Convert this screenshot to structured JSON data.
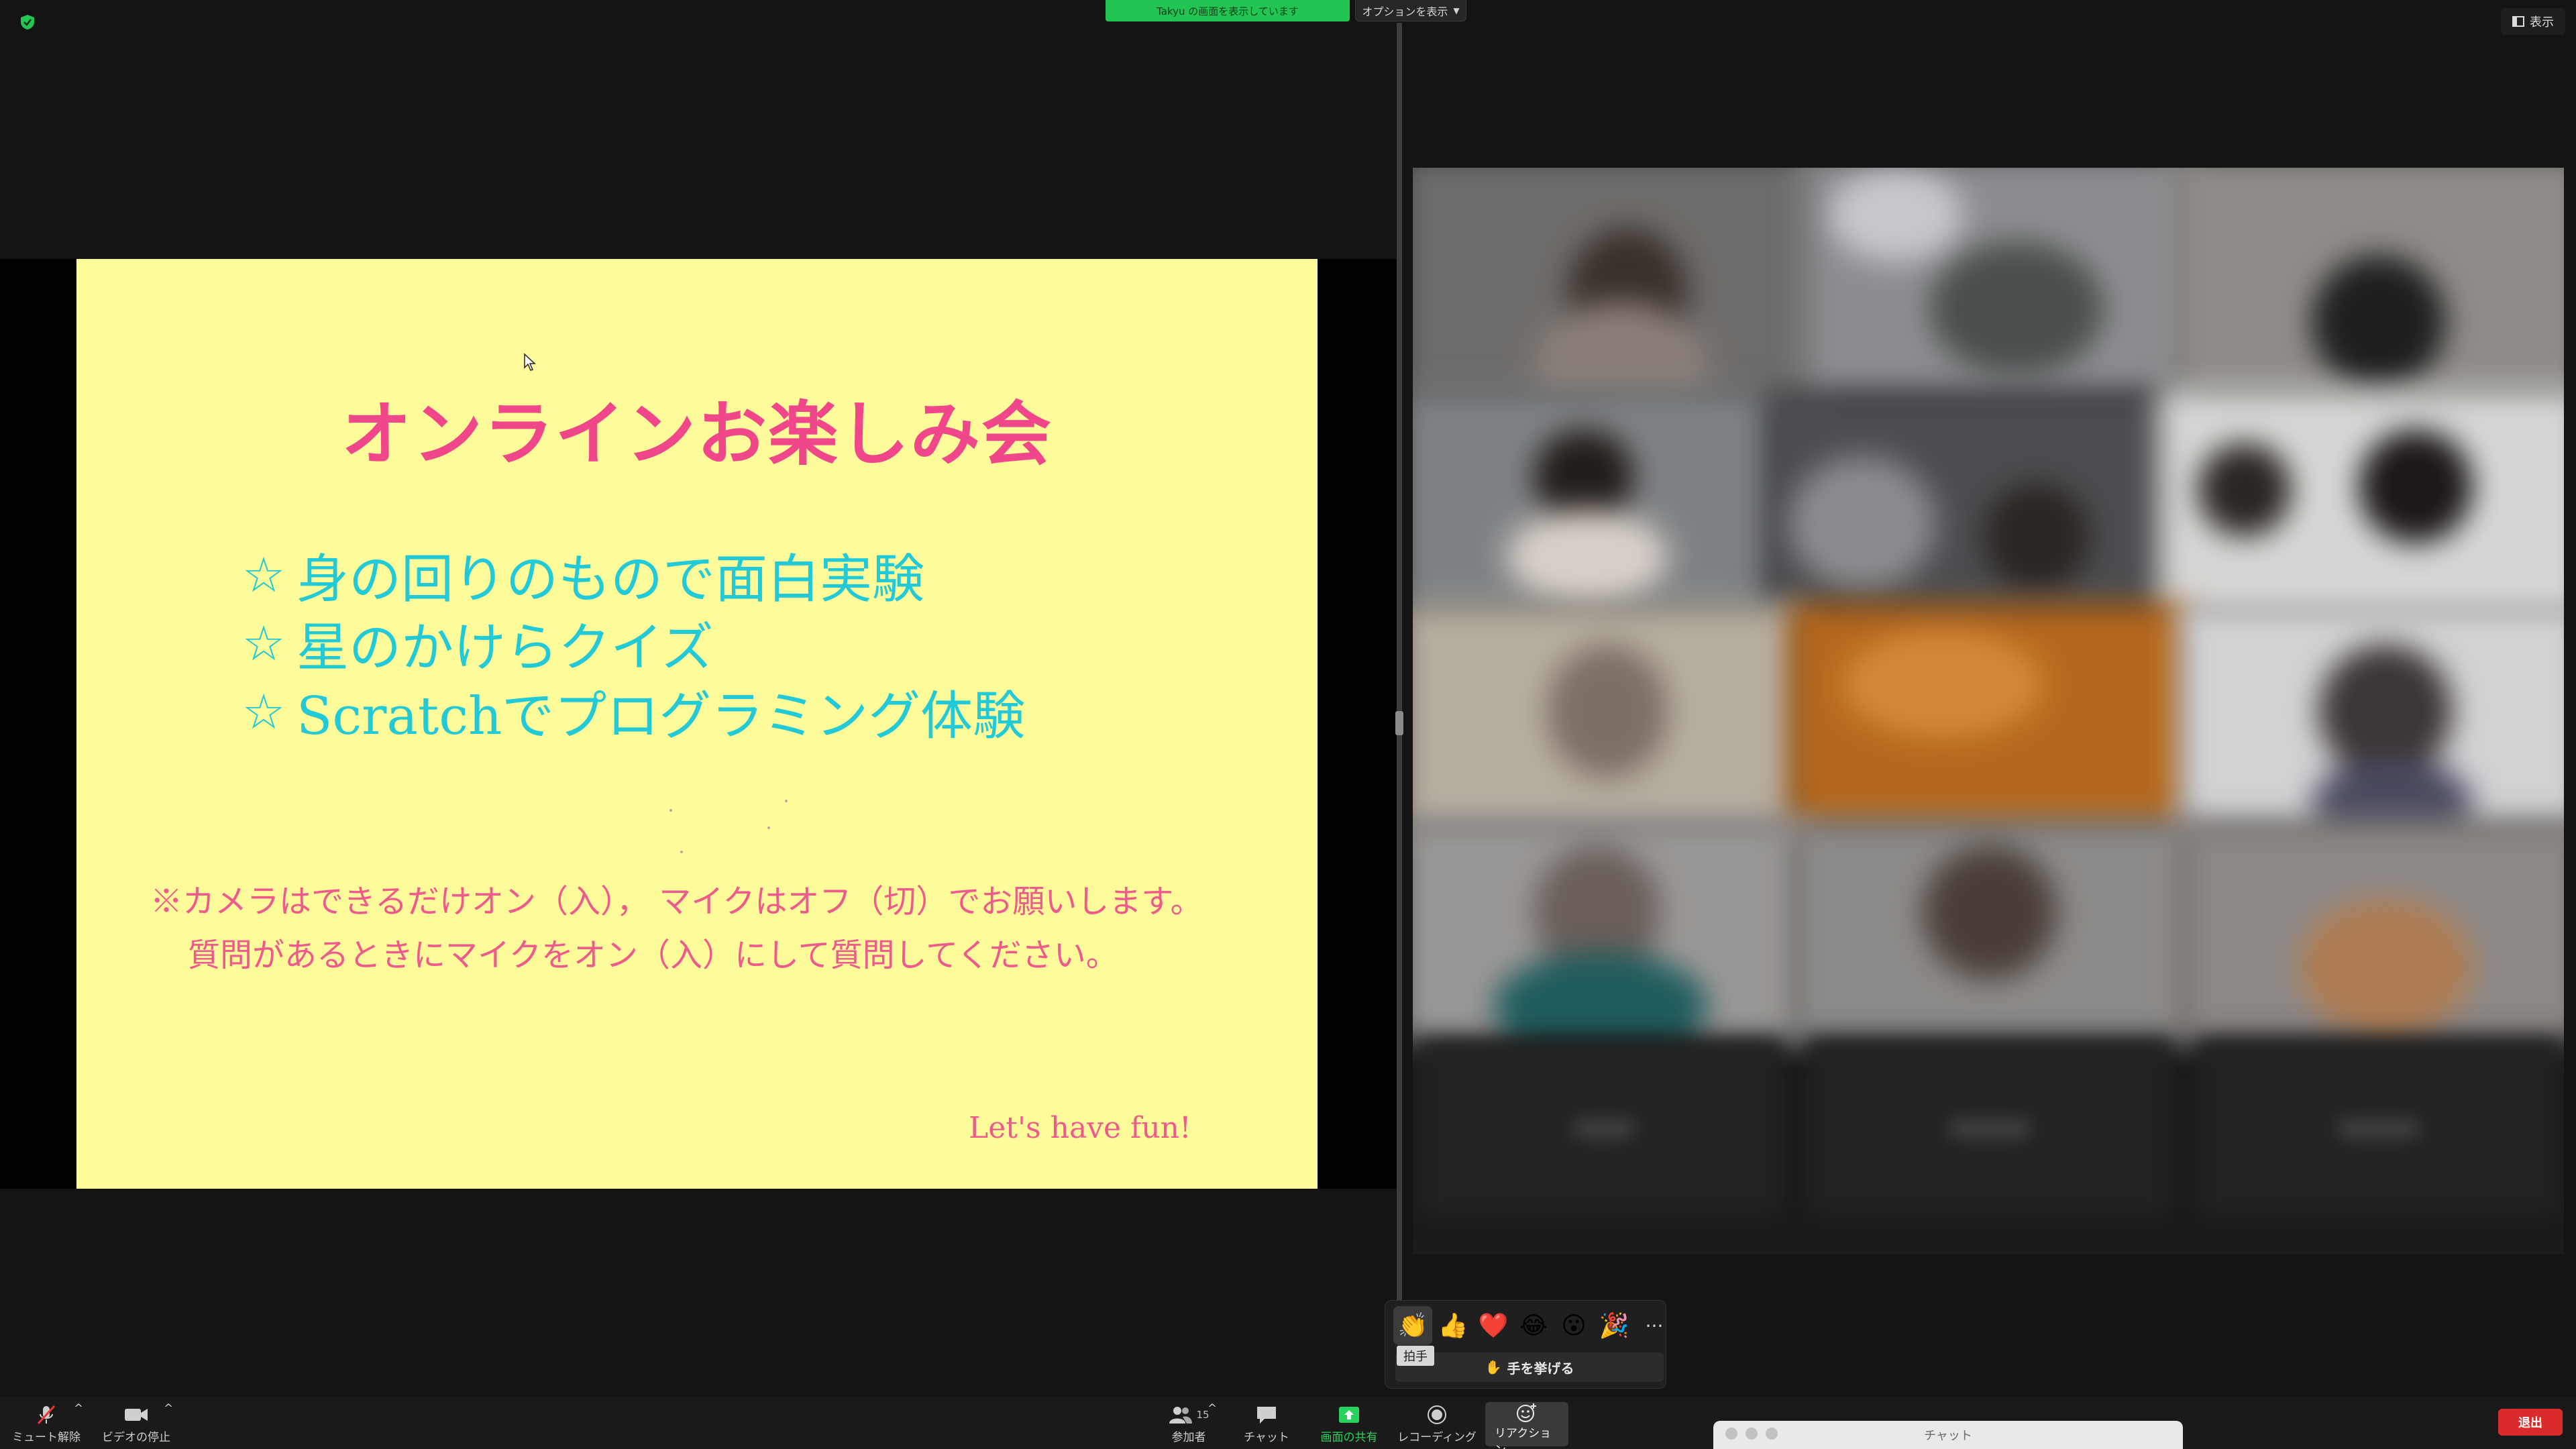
{
  "top": {
    "sharing_banner": "Takyu の画面を表示しています",
    "options_label": "オプションを表示",
    "view_label": "表示"
  },
  "slide": {
    "title": "オンラインお楽しみ会",
    "items": [
      {
        "star": "☆",
        "text": "身の回りのもので面白実験"
      },
      {
        "star": "☆",
        "text": "星のかけらクイズ"
      },
      {
        "star": "☆",
        "text": "Scratchでプログラミング体験"
      }
    ],
    "note_line1": "※カメラはできるだけオン（入）， マイクはオフ（切）でお願いします。",
    "note_line2": "質問があるときにマイクをオン（入）にして質問してください。",
    "footer": "Let's have fun!"
  },
  "reactions": {
    "items": [
      {
        "icon": "clapping-hands-icon",
        "glyph": "👏"
      },
      {
        "icon": "thumbs-up-icon",
        "glyph": "👍"
      },
      {
        "icon": "heart-icon",
        "glyph": "❤️"
      },
      {
        "icon": "tears-of-joy-icon",
        "glyph": "😂"
      },
      {
        "icon": "open-mouth-icon",
        "glyph": "😮"
      },
      {
        "icon": "party-popper-icon",
        "glyph": "🎉"
      }
    ],
    "more_glyph": "···",
    "tooltip": "拍手",
    "raise_hand_glyph": "✋",
    "raise_hand_label": "手を挙げる"
  },
  "toolbar": {
    "unmute_label": "ミュート解除",
    "stop_video_label": "ビデオの停止",
    "participants_label": "参加者",
    "participants_count": "15",
    "chat_label": "チャット",
    "share_label": "画面の共有",
    "record_label": "レコーディング",
    "reaction_label": "リアクション",
    "leave_label": "退出",
    "caret": "^"
  },
  "chat_window": {
    "title": "チャット"
  },
  "colors": {
    "slide_bg": "#fefb9a",
    "title_pink": "#f0478a",
    "item_cyan": "#22c9d6",
    "share_green": "#23c552",
    "leave_red": "#d92b2b"
  }
}
